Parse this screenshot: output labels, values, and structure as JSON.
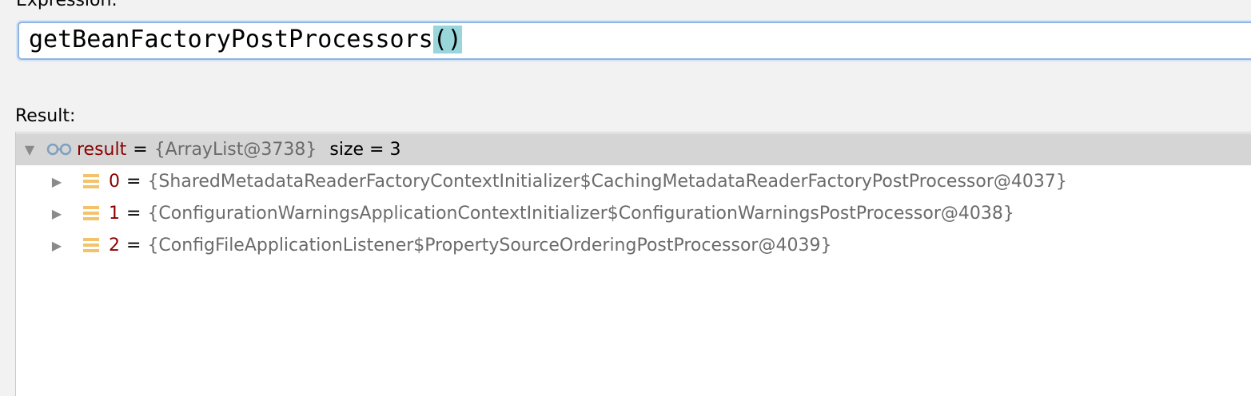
{
  "expression": {
    "label": "Expression:",
    "text_main": "getBeanFactoryPostProcessors",
    "text_parens": "()"
  },
  "result": {
    "label": "Result:",
    "root": {
      "name": "result",
      "eq": "=",
      "value": "{ArrayList@3738}",
      "size": "size = 3"
    },
    "items": [
      {
        "name": "0",
        "eq": "=",
        "value": "{SharedMetadataReaderFactoryContextInitializer$CachingMetadataReaderFactoryPostProcessor@4037}"
      },
      {
        "name": "1",
        "eq": "=",
        "value": "{ConfigurationWarningsApplicationContextInitializer$ConfigurationWarningsPostProcessor@4038}"
      },
      {
        "name": "2",
        "eq": "=",
        "value": "{ConfigFileApplicationListener$PropertySourceOrderingPostProcessor@4039}"
      }
    ]
  },
  "colors": {
    "name": "#8b0000",
    "value": "#6b6b6b",
    "selected_row": "#d5d5d5",
    "paren_highlight": "#99d6dc",
    "field_icon": "#f2c36b"
  },
  "icons": {
    "root_expand": "chevron-down-icon",
    "child_expand": "chevron-right-icon",
    "watch": "glasses-icon",
    "field": "field-icon"
  }
}
